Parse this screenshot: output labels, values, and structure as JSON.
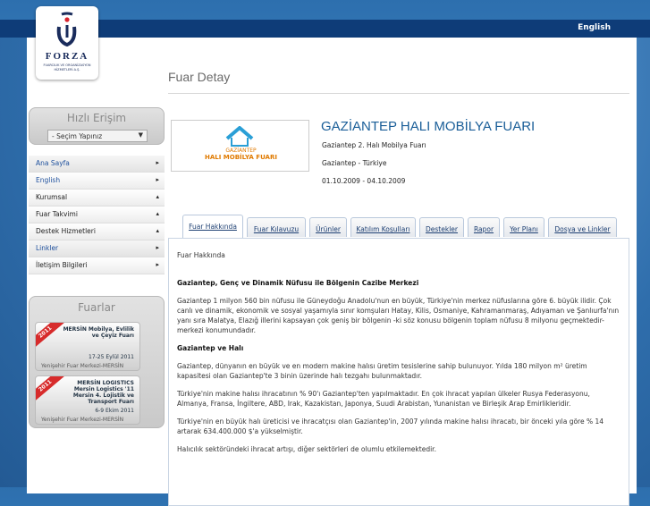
{
  "header": {
    "language_link": "English"
  },
  "logo": {
    "name": "FORZA",
    "subtitle": "FUARCILIK VE ORGANİZASYON HİZMETLERİ A.Ş."
  },
  "sidebar": {
    "quick_access": {
      "title": "Hızlı Erişim",
      "select_value": "- Seçim Yapınız"
    },
    "menu": [
      {
        "label": "Ana Sayfa",
        "arrow": "▸"
      },
      {
        "label": "English",
        "arrow": "▸"
      },
      {
        "label": "Kurumsal",
        "arrow": "▴"
      },
      {
        "label": "Fuar Takvimi",
        "arrow": "▴"
      },
      {
        "label": "Destek Hizmetleri",
        "arrow": "▴"
      },
      {
        "label": "Linkler",
        "arrow": "▸"
      },
      {
        "label": "İletişim Bilgileri",
        "arrow": "▸"
      }
    ],
    "fairs": {
      "title": "Fuarlar",
      "items": [
        {
          "ribbon": "2011",
          "title": "MERSİN Mobilya, Evlilik ve Çeyiz Fuarı",
          "date": "17-25 Eylül 2011",
          "venue": "Yenişehir Fuar Merkezi-MERSİN"
        },
        {
          "ribbon": "2011",
          "title": "MERSİN LOGISTICS Mersin Logistics '11 Mersin 4. Lojistik ve Transport Fuarı",
          "date": "6-9 Ekim 2011",
          "venue": "Yenişehir Fuar Merkezi-MERSİN"
        }
      ]
    }
  },
  "main": {
    "page_title": "Fuar Detay",
    "fair": {
      "logo_top": "GAZİANTEP",
      "logo_bottom": "HALI MOBİLYA FUARI",
      "name": "GAZİANTEP HALI MOBİLYA FUARI",
      "subtitle": "Gaziantep 2. Halı Mobilya Fuarı",
      "location": "Gaziantep - Türkiye",
      "dates": "01.10.2009 - 04.10.2009"
    },
    "tabs": [
      "Fuar Hakkında",
      "Fuar Kılavuzu",
      "Ürünler",
      "Katılım Koşulları",
      "Destekler",
      "Rapor",
      "Yer Planı",
      "Dosya ve Linkler"
    ],
    "content": {
      "intro": "Fuar Hakkında",
      "h1": "Gaziantep, Genç ve Dinamik Nüfusu ile Bölgenin Cazibe Merkezi",
      "p1": "Gaziantep 1 milyon 560 bin nüfusu ile Güneydoğu Anadolu'nun en büyük, Türkiye'nin merkez nüfuslarına göre 6. büyük ilidir. Çok canlı ve dinamik, ekonomik ve sosyal yaşamıyla sınır komşuları Hatay, Kilis, Osmaniye, Kahramanmaraş, Adıyaman ve Şanlıurfa'nın yanı sıra Malatya, Elazığ illerini kapsayan çok geniş bir bölgenin -ki söz konusu bölgenin toplam nüfusu 8 milyonu geçmektedir- merkezi konumundadır.",
      "h2": "Gaziantep ve Halı",
      "p2": "Gaziantep, dünyanın en büyük ve en modern makine halısı üretim tesislerine sahip bulunuyor. Yılda 180 milyon m² üretim kapasitesi olan Gaziantep'te 3 binin üzerinde halı tezgahı bulunmaktadır.",
      "p3": "Türkiye'nin makine halısı ihracatının % 90'ı Gaziantep'ten yapılmaktadır. En çok ihracat yapılan ülkeler Rusya Federasyonu, Almanya, Fransa, İngiltere, ABD, Irak, Kazakistan, Japonya, Suudi Arabistan, Yunanistan ve Birleşik Arap Emirlikleridir.",
      "p4": "Türkiye'nin en büyük halı üreticisi ve ihracatçısı olan Gaziantep'in, 2007 yılında makine halısı ihracatı, bir önceki yıla göre % 14 artarak 634.400.000 $'a yükselmiştir.",
      "p5": "Halıcılık sektöründeki ihracat artışı, diğer sektörleri de olumlu etkilemektedir."
    }
  }
}
